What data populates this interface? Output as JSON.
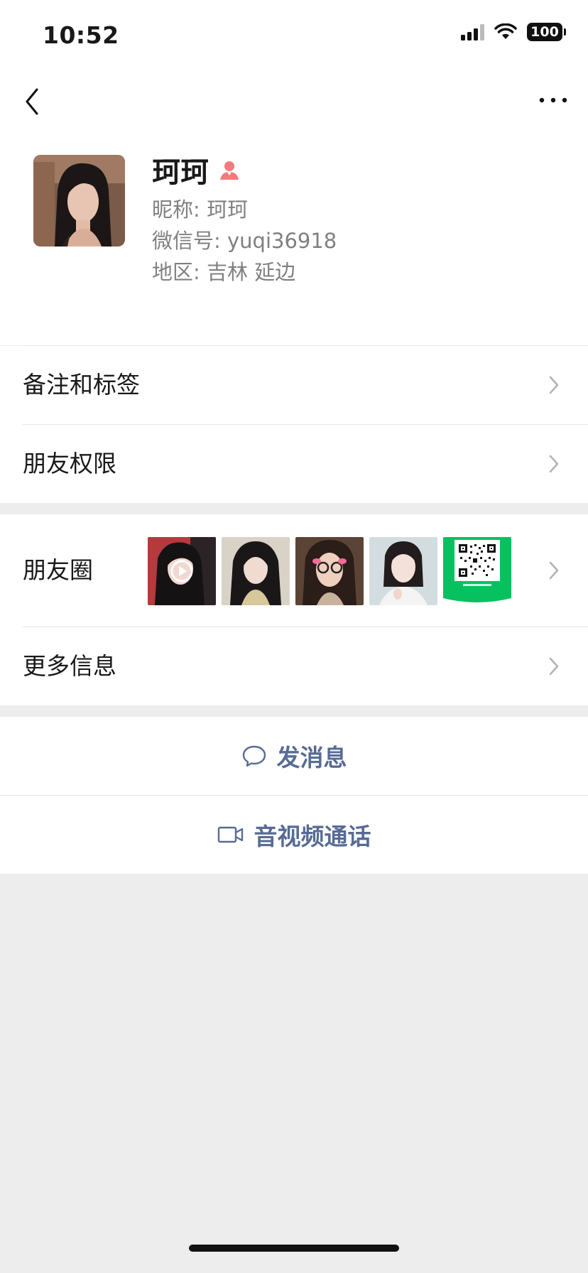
{
  "status": {
    "time": "10:52",
    "battery": "100"
  },
  "profile": {
    "name": "珂珂",
    "nickname": "昵称: 珂珂",
    "wechat_id": "微信号: yuqi36918",
    "region": "地区: 吉林 延边"
  },
  "rows": {
    "remarks": "备注和标签",
    "permissions": "朋友权限",
    "moments": "朋友圈",
    "more_info": "更多信息"
  },
  "actions": {
    "message": "发消息",
    "call": "音视频通话"
  },
  "colors": {
    "link": "#576b95",
    "female_badge": "#f37b7b",
    "qr_green": "#07c160"
  },
  "icons": {
    "back": "chevron-left-icon",
    "more": "ellipsis-icon",
    "gender": "female-icon",
    "message": "chat-bubble-icon",
    "call": "video-camera-icon"
  }
}
